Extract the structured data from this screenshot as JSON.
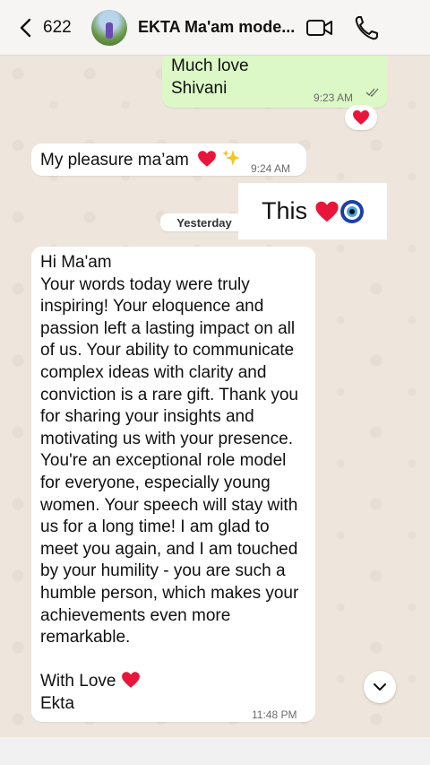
{
  "header": {
    "back_count": "622",
    "chat_title": "EKTA Ma'am mode..."
  },
  "messages": {
    "m1_text_line1": "Much love",
    "m1_text_line2": "Shivani",
    "m1_time": "9:23 AM",
    "m2_text": "My pleasure ma’am",
    "m2_time": "9:24 AM",
    "sticker_text": "This",
    "date_separator": "Yesterday",
    "m3_lines": [
      "Hi Ma'am",
      "Your words today were truly",
      "inspiring! Your eloquence and",
      "passion left a lasting impact on all",
      "of us. Your ability to communicate",
      "complex ideas with clarity and",
      "conviction is a rare gift. Thank you",
      "for sharing your insights and",
      "motivating us with your presence.",
      "You're an exceptional role model",
      "for everyone, especially young",
      "women. Your speech will stay with",
      "us for a long time! I am glad to",
      "meet you again, and I am touched",
      "by your humility - you are such a",
      "humble person, which makes your",
      "achievements even more",
      "remarkable.",
      "",
      "With Love",
      "Ekta"
    ],
    "m3_time": "11:48 PM"
  },
  "colors": {
    "outgoing_bubble": "#dcf8c6",
    "incoming_bubble": "#ffffff",
    "heart_red": "#e8163a",
    "read_ticks": "#6b6b6b"
  },
  "icons": {
    "back": "chevron-left-icon",
    "video": "video-camera-icon",
    "call": "phone-icon",
    "heart": "red-heart-emoji",
    "sparkles": "sparkles-emoji",
    "evil_eye": "nazar-amulet-emoji",
    "scroll": "chevron-down-icon"
  }
}
